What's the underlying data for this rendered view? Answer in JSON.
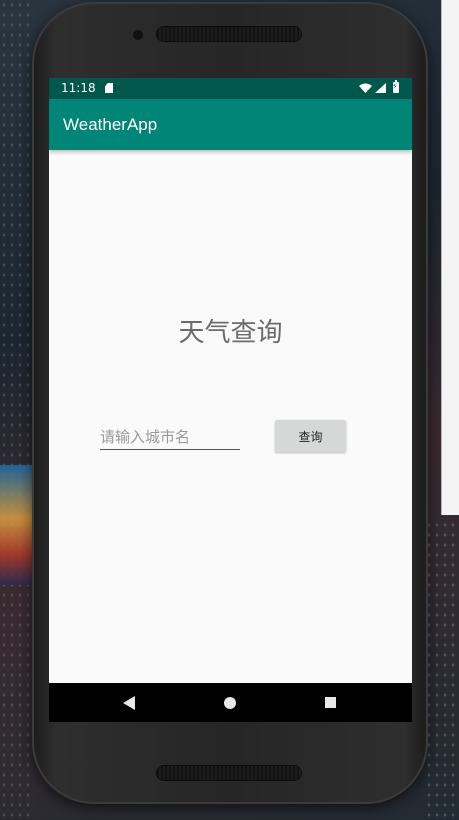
{
  "status_bar": {
    "time": "11:18",
    "icons": [
      "sd-card-icon",
      "wifi-icon",
      "signal-icon",
      "battery-charging-icon"
    ]
  },
  "app_bar": {
    "title": "WeatherApp",
    "color": "#008577"
  },
  "main": {
    "title": "天气查询",
    "city_input": {
      "value": "",
      "placeholder": "请输入城市名"
    },
    "query_button_label": "查询"
  },
  "nav_bar": {
    "icons": [
      "back-icon",
      "home-icon",
      "recent-apps-icon"
    ]
  },
  "colors": {
    "status_bar": "#00574b",
    "app_bar": "#008577",
    "screen_background": "#fafafa",
    "button_background": "#d6d7d7"
  }
}
